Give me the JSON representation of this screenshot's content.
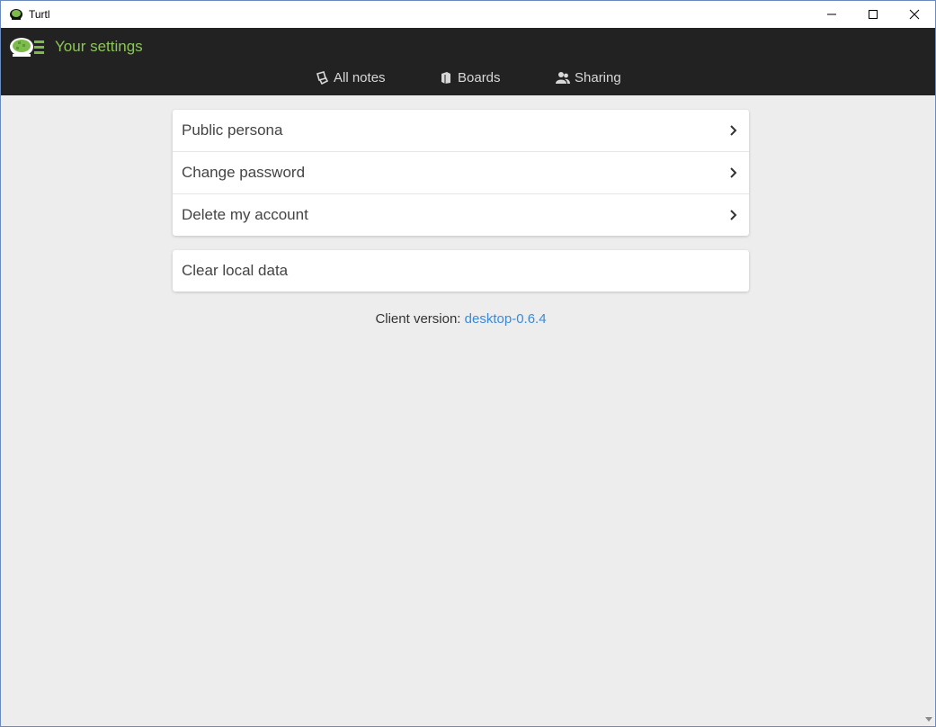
{
  "window": {
    "title": "Turtl"
  },
  "header": {
    "title": "Your settings",
    "nav": [
      {
        "label": "All notes",
        "icon": "notes-icon"
      },
      {
        "label": "Boards",
        "icon": "boards-icon"
      },
      {
        "label": "Sharing",
        "icon": "sharing-icon"
      }
    ]
  },
  "settings": {
    "items": [
      {
        "label": "Public persona"
      },
      {
        "label": "Change password"
      },
      {
        "label": "Delete my account"
      }
    ],
    "clear_label": "Clear local data"
  },
  "footer": {
    "version_label": "Client version:",
    "version_value": "desktop-0.6.4"
  },
  "colors": {
    "header_bg": "#222222",
    "accent_green": "#8dc45a",
    "link_blue": "#3b8ad8",
    "page_bg": "#ededed"
  }
}
